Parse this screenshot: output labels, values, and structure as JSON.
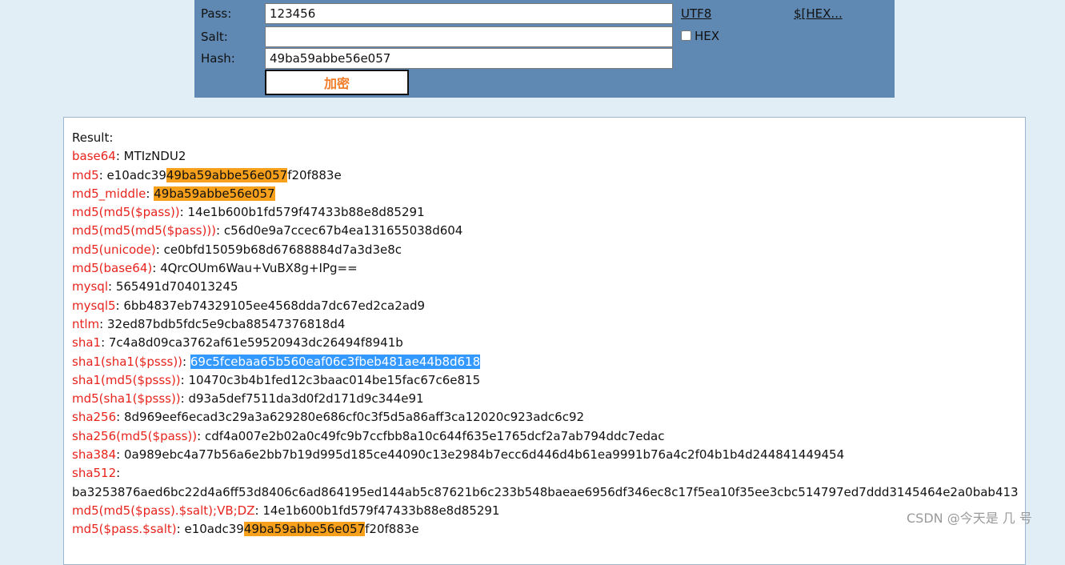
{
  "form": {
    "pass_label": "Pass:",
    "salt_label": "Salt:",
    "hash_label": "Hash:",
    "pass_value": "123456",
    "salt_value": "",
    "hash_value": "49ba59abbe56e057",
    "encrypt_button": "加密",
    "utf8_link": "UTF8",
    "hex_link": "$[HEX...",
    "hex_checkbox_label": "HEX",
    "hex_checked": false
  },
  "result": {
    "title": "Result:",
    "rows": [
      {
        "key": "base64",
        "value": "MTIzNDU2"
      },
      {
        "key": "md5",
        "value": "e10adc3949ba59abbe56e057f20f883e",
        "highlight": "49ba59abbe56e057"
      },
      {
        "key": "md5_middle",
        "value": "49ba59abbe56e057",
        "highlight": "49ba59abbe56e057"
      },
      {
        "key": "md5(md5($pass))",
        "value": "14e1b600b1fd579f47433b88e8d85291"
      },
      {
        "key": "md5(md5(md5($pass)))",
        "value": "c56d0e9a7ccec67b4ea131655038d604"
      },
      {
        "key": "md5(unicode)",
        "value": "ce0bfd15059b68d67688884d7a3d3e8c"
      },
      {
        "key": "md5(base64)",
        "value": "4QrcOUm6Wau+VuBX8g+IPg=="
      },
      {
        "key": "mysql",
        "value": "565491d704013245"
      },
      {
        "key": "mysql5",
        "value": "6bb4837eb74329105ee4568dda7dc67ed2ca2ad9"
      },
      {
        "key": "ntlm",
        "value": "32ed87bdb5fdc5e9cba88547376818d4"
      },
      {
        "key": "sha1",
        "value": "7c4a8d09ca3762af61e59520943dc26494f8941b"
      },
      {
        "key": "sha1(sha1($psss))",
        "value": "69c5fcebaa65b560eaf06c3fbeb481ae44b8d618",
        "selected": true
      },
      {
        "key": "sha1(md5($psss))",
        "value": "10470c3b4b1fed12c3baac014be15fac67c6e815"
      },
      {
        "key": "md5(sha1($psss))",
        "value": "d93a5def7511da3d0f2d171d9c344e91"
      },
      {
        "key": "sha256",
        "value": "8d969eef6ecad3c29a3a629280e686cf0c3f5d5a86aff3ca12020c923adc6c92"
      },
      {
        "key": "sha256(md5($pass))",
        "value": "cdf4a007e2b02a0c49fc9b7ccfbb8a10c644f635e1765dcf2a7ab794ddc7edac"
      },
      {
        "key": "sha384",
        "value": "0a989ebc4a77b56a6e2bb7b19d995d185ce44090c13e2984b7ecc6d446d4b61ea9991b76a4c2f04b1b4d244841449454"
      },
      {
        "key": "sha512",
        "value": "ba3253876aed6bc22d4a6ff53d8406c6ad864195ed144ab5c87621b6c233b548baeae6956df346ec8c17f5ea10f35ee3cbc514797ed7ddd3145464e2a0bab413",
        "wrap": true
      },
      {
        "key": "md5(md5($pass).$salt);VB;DZ",
        "value": "14e1b600b1fd579f47433b88e8d85291"
      },
      {
        "key": "md5($pass.$salt)",
        "value": "e10adc3949ba59abbe56e057f20f883e",
        "highlight": "49ba59abbe56e057"
      }
    ]
  },
  "watermark": "CSDN @今天是 几 号"
}
